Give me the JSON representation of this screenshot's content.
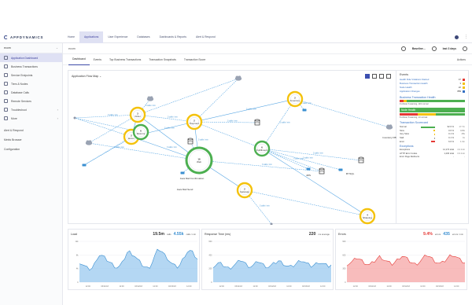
{
  "brand": {
    "name": "APPDYNAMICS"
  },
  "topnav": [
    "Home",
    "Applications",
    "User Experience",
    "Databases",
    "Dashboards & Reports",
    "Alert & Respond"
  ],
  "sidebar": {
    "app_label": "ecom",
    "items": [
      {
        "label": "Application Dashboard",
        "active": true,
        "chevron": false
      },
      {
        "label": "Business Transactions",
        "active": false,
        "chevron": false
      },
      {
        "label": "Service Endpoints",
        "active": false,
        "chevron": false
      },
      {
        "label": "Tiers & Nodes",
        "active": false,
        "chevron": false
      },
      {
        "label": "Database Calls",
        "active": false,
        "chevron": false
      },
      {
        "label": "Remote Services",
        "active": false,
        "chevron": false
      },
      {
        "label": "Troubleshoot",
        "active": false,
        "chevron": true
      },
      {
        "label": "More",
        "active": false,
        "chevron": true
      }
    ],
    "plain_items": [
      "Alert & Respond",
      "Metric Browser",
      "Configuration"
    ]
  },
  "crumb": {
    "label": "ecom",
    "time_range": "last 3 days",
    "action_label": "Baseline..."
  },
  "tabs": [
    "Dashboard",
    "Events",
    "Top Business Transactions",
    "Transaction Snapshots",
    "Transaction Score"
  ],
  "tabs_actions": "Actions",
  "flowmap": {
    "title": "Application Flow Map",
    "nodes": [
      {
        "id": "n1",
        "label": "Order",
        "kind": "tier",
        "ring": "#f4c20d",
        "count": "3"
      },
      {
        "id": "n2",
        "label": "Inventory",
        "kind": "tier",
        "ring": "#f4c20d",
        "count": "2"
      },
      {
        "id": "n3",
        "label": "Ecom",
        "kind": "tier",
        "ring": "#f4c20d",
        "count": "2"
      },
      {
        "id": "n4",
        "label": "Payment",
        "kind": "tier",
        "ring": "#f4c20d",
        "count": "2"
      },
      {
        "id": "n5",
        "label": "Web",
        "kind": "tier",
        "ring": "#4caf50",
        "count": "16"
      },
      {
        "id": "n6",
        "label": "Fulfillment",
        "kind": "tier",
        "ring": "#4caf50",
        "count": "6"
      },
      {
        "id": "n7",
        "label": "Gateway",
        "kind": "tier",
        "ring": "#f4c20d",
        "count": "2"
      },
      {
        "id": "n8",
        "label": "Shipping",
        "kind": "tier",
        "ring": "#f4c20d",
        "count": "4"
      },
      {
        "id": "n9",
        "label": "Returns",
        "kind": "tier",
        "ring": "#4caf50",
        "count": "6"
      }
    ],
    "backend_labels": [
      "Java Mail Send",
      "Java Mail Confirmation",
      "JMS",
      "MYSQL",
      "Inventory DB"
    ],
    "edge_label": "3 calls / min"
  },
  "rpanel": {
    "events_title": "Events",
    "events": [
      {
        "label": "Health Rule Violations Started",
        "value": "47",
        "color": "#e53935"
      },
      {
        "label": "Business Transaction Health",
        "value": "3",
        "color": "#f4c20d"
      },
      {
        "label": "Node Health",
        "value": "22",
        "color": "#f4c20d"
      },
      {
        "label": "Application Changes",
        "value": "889",
        "color": "#3470c3"
      }
    ],
    "bt_health_title": "Business Transaction Health",
    "bt_health_note": "9 critical, 6 warning, 116 normal",
    "node_health_title": "Node Health",
    "node_health_note": "8 critical, 8 warning, 13 normal",
    "scorecard_title": "Transaction Scorecard",
    "scorecard": [
      {
        "label": "Normal",
        "pct": "92.6 %",
        "count": "17.7m"
      },
      {
        "label": "Slow",
        "pct": "0.6 %",
        "count": "106k"
      },
      {
        "label": "Very Slow",
        "pct": "0.1 %",
        "count": "25k"
      },
      {
        "label": "Stall",
        "pct": "0.1 %",
        "count": "1k"
      },
      {
        "label": "Error",
        "pct": "6.6 %",
        "count": "1.3m"
      }
    ],
    "exceptions_title": "Exceptions",
    "exceptions": [
      {
        "label": "Exceptions",
        "value": "14,173 total",
        "rate": "2.2 /min"
      },
      {
        "label": "HTTP Error Codes",
        "value": "1,230 total",
        "rate": "0.3 /min"
      },
      {
        "label": "Error Page Redirects",
        "value": "-",
        "rate": "-"
      }
    ]
  },
  "charts": [
    {
      "title": "Load",
      "m1": "19.5m",
      "u1": "calls",
      "m2": "4.55k",
      "u2": "calls / min",
      "m2_color": "#3a8fd1",
      "fill": "#9bc9ef",
      "stroke": "#3a8fd1",
      "ticks": [
        "12:00",
        "03/11/18",
        "12:00",
        "03/12/18",
        "12:00",
        "03/13/18",
        "12:00"
      ],
      "y_labels": [
        "12k",
        "8k",
        "4k",
        "0"
      ],
      "series": [
        0.45,
        0.4,
        0.35,
        0.3,
        0.28,
        0.3,
        0.4,
        0.55,
        0.62,
        0.6,
        0.55,
        0.5,
        0.45,
        0.4,
        0.35,
        0.32,
        0.35,
        0.42,
        0.55,
        0.68,
        0.7,
        0.65,
        0.6,
        0.52,
        0.45,
        0.38,
        0.33,
        0.3,
        0.34,
        0.45,
        0.6,
        0.72,
        0.75,
        0.7,
        0.62,
        0.55,
        0.47,
        0.4,
        0.35,
        0.33,
        0.38,
        0.5,
        0.62,
        0.7,
        0.72,
        0.68,
        0.6,
        0.52
      ]
    },
    {
      "title": "Response Time (ms)",
      "m1": "220",
      "u1": "ms average",
      "m2": "",
      "u2": "",
      "m2_color": "#3a8fd1",
      "fill": "#9bc9ef",
      "stroke": "#3a8fd1",
      "ticks": [
        "12:00",
        "03/11/18",
        "12:00",
        "03/12/18",
        "12:00",
        "03/13/18",
        "12:00"
      ],
      "y_labels": [
        "600",
        "400",
        "200",
        "0"
      ],
      "series": [
        0.35,
        0.38,
        0.42,
        0.4,
        0.37,
        0.33,
        0.3,
        0.32,
        0.36,
        0.4,
        0.45,
        0.5,
        0.46,
        0.4,
        0.36,
        0.34,
        0.37,
        0.42,
        0.47,
        0.43,
        0.38,
        0.35,
        0.33,
        0.36,
        0.4,
        0.44,
        0.48,
        0.45,
        0.41,
        0.37,
        0.34,
        0.33,
        0.36,
        0.41,
        0.46,
        0.5,
        0.47,
        0.42,
        0.38,
        0.35,
        0.37,
        0.41,
        0.45,
        0.43,
        0.4,
        0.37,
        0.35,
        0.38
      ]
    },
    {
      "title": "Errors",
      "m1": "9.4%",
      "u1": "errors",
      "m2": "435",
      "u2": "errors / min",
      "m2_color": "#3a8fd1",
      "m1_color": "#e53935",
      "fill": "#f5a5a5",
      "stroke": "#e53935",
      "ticks": [
        "12:00",
        "03/11/18",
        "12:00",
        "03/12/18",
        "12:00",
        "03/13/18",
        "12:00"
      ],
      "y_labels": [
        "900",
        "600",
        "300",
        "0"
      ],
      "series": [
        0.4,
        0.42,
        0.45,
        0.5,
        0.55,
        0.52,
        0.48,
        0.44,
        0.4,
        0.38,
        0.42,
        0.47,
        0.53,
        0.58,
        0.55,
        0.5,
        0.46,
        0.42,
        0.4,
        0.44,
        0.5,
        0.56,
        0.6,
        0.57,
        0.52,
        0.47,
        0.43,
        0.4,
        0.42,
        0.46,
        0.52,
        0.58,
        0.62,
        0.58,
        0.53,
        0.48,
        0.44,
        0.41,
        0.43,
        0.48,
        0.54,
        0.6,
        0.63,
        0.6,
        0.55,
        0.5,
        0.46,
        0.43
      ]
    }
  ]
}
